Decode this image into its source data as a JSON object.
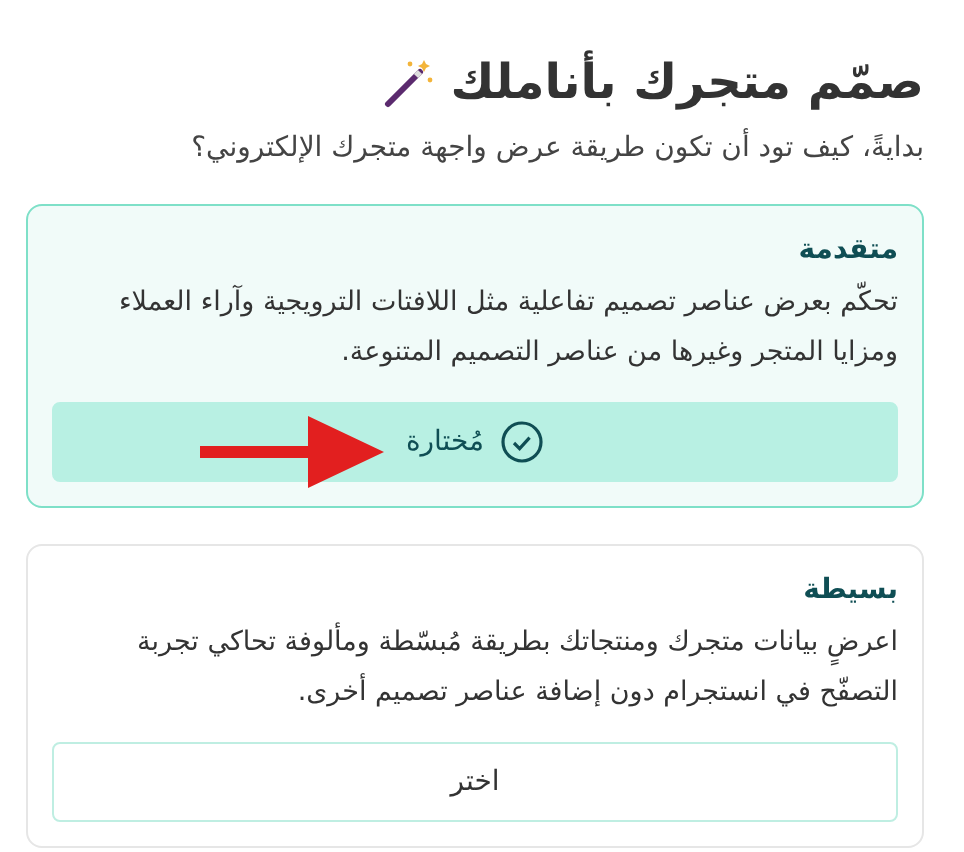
{
  "title": "صمّم متجرك بأناملك",
  "subtitle": "بدايةً، كيف تود أن تكون طريقة عرض واجهة متجرك الإلكتروني؟",
  "options": [
    {
      "name": "متقدمة",
      "description": "تحكّم بعرض عناصر تصميم تفاعلية مثل اللافتات الترويجية وآراء العملاء ومزايا المتجر وغيرها من عناصر التصميم المتنوعة.",
      "button": "مُختارة",
      "selected": true
    },
    {
      "name": "بسيطة",
      "description": "اعرضٍ بيانات متجرك ومنتجاتك بطريقة مُبسّطة ومألوفة تحاكي تجربة التصفّح في انستجرام دون إضافة عناصر تصميم أخرى.",
      "button": "اختر",
      "selected": false
    }
  ]
}
